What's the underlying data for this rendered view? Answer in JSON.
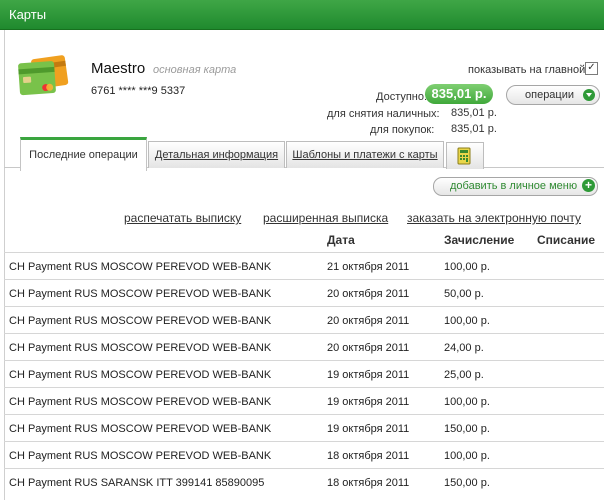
{
  "window": {
    "title": "Карты"
  },
  "card": {
    "name": "Maestro",
    "type_label": "основная карта",
    "number": "6761 **** ***9 5337"
  },
  "show_on_main": {
    "label": "показывать на главной",
    "checked": true,
    "mark": "✓"
  },
  "balance": {
    "available_label": "Доступно:",
    "available_value": "835,01 р.",
    "cash_label": "для снятия наличных:",
    "cash_value": "835,01 р.",
    "purchase_label": "для покупок:",
    "purchase_value": "835,01 р.",
    "accent_color": "#3fa83a"
  },
  "operations_button": {
    "label": "операции"
  },
  "tabs": [
    {
      "label": "Последние операции",
      "active": true
    },
    {
      "label": "Детальная информация",
      "active": false
    },
    {
      "label": "Шаблоны и платежи с карты",
      "active": false
    }
  ],
  "tab_extra_icon": "calculator-icon",
  "favorites_button": {
    "label": "добавить в личное меню"
  },
  "actions": {
    "print": "распечатать выписку",
    "extended": "расширенная выписка",
    "email": "заказать на электронную почту"
  },
  "table": {
    "headers": {
      "date": "Дата",
      "credit": "Зачисление",
      "debit": "Списание"
    },
    "rows": [
      {
        "desc": "CH Payment RUS MOSCOW PEREVOD WEB-BANK",
        "date": "21 октября 2011",
        "credit": "100,00 р.",
        "debit": ""
      },
      {
        "desc": "CH Payment RUS MOSCOW PEREVOD WEB-BANK",
        "date": "20 октября 2011",
        "credit": "50,00 р.",
        "debit": ""
      },
      {
        "desc": "CH Payment RUS MOSCOW PEREVOD WEB-BANK",
        "date": "20 октября 2011",
        "credit": "100,00 р.",
        "debit": ""
      },
      {
        "desc": "CH Payment RUS MOSCOW PEREVOD WEB-BANK",
        "date": "20 октября 2011",
        "credit": "24,00 р.",
        "debit": ""
      },
      {
        "desc": "CH Payment RUS MOSCOW PEREVOD WEB-BANK",
        "date": "19 октября 2011",
        "credit": "25,00 р.",
        "debit": ""
      },
      {
        "desc": "CH Payment RUS MOSCOW PEREVOD WEB-BANK",
        "date": "19 октября 2011",
        "credit": "100,00 р.",
        "debit": ""
      },
      {
        "desc": "CH Payment RUS MOSCOW PEREVOD WEB-BANK",
        "date": "19 октября 2011",
        "credit": "150,00 р.",
        "debit": ""
      },
      {
        "desc": "CH Payment RUS MOSCOW PEREVOD WEB-BANK",
        "date": "18 октября 2011",
        "credit": "100,00 р.",
        "debit": ""
      },
      {
        "desc": "CH Payment RUS SARANSK ITT 399141 85890095",
        "date": "18 октября 2011",
        "credit": "150,00 р.",
        "debit": ""
      }
    ]
  }
}
